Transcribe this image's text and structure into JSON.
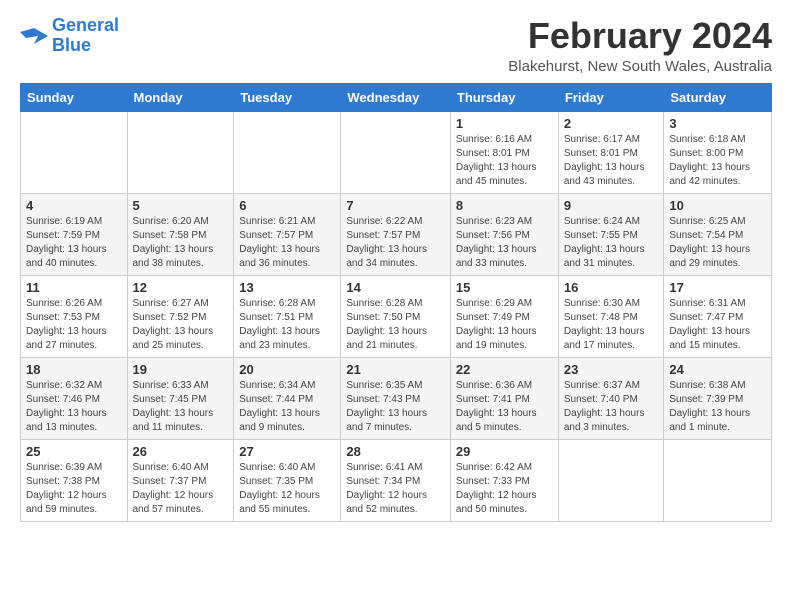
{
  "logo": {
    "text_general": "General",
    "text_blue": "Blue"
  },
  "header": {
    "title": "February 2024",
    "subtitle": "Blakehurst, New South Wales, Australia"
  },
  "days_of_week": [
    "Sunday",
    "Monday",
    "Tuesday",
    "Wednesday",
    "Thursday",
    "Friday",
    "Saturday"
  ],
  "weeks": [
    [
      {
        "day": "",
        "detail": ""
      },
      {
        "day": "",
        "detail": ""
      },
      {
        "day": "",
        "detail": ""
      },
      {
        "day": "",
        "detail": ""
      },
      {
        "day": "1",
        "detail": "Sunrise: 6:16 AM\nSunset: 8:01 PM\nDaylight: 13 hours\nand 45 minutes."
      },
      {
        "day": "2",
        "detail": "Sunrise: 6:17 AM\nSunset: 8:01 PM\nDaylight: 13 hours\nand 43 minutes."
      },
      {
        "day": "3",
        "detail": "Sunrise: 6:18 AM\nSunset: 8:00 PM\nDaylight: 13 hours\nand 42 minutes."
      }
    ],
    [
      {
        "day": "4",
        "detail": "Sunrise: 6:19 AM\nSunset: 7:59 PM\nDaylight: 13 hours\nand 40 minutes."
      },
      {
        "day": "5",
        "detail": "Sunrise: 6:20 AM\nSunset: 7:58 PM\nDaylight: 13 hours\nand 38 minutes."
      },
      {
        "day": "6",
        "detail": "Sunrise: 6:21 AM\nSunset: 7:57 PM\nDaylight: 13 hours\nand 36 minutes."
      },
      {
        "day": "7",
        "detail": "Sunrise: 6:22 AM\nSunset: 7:57 PM\nDaylight: 13 hours\nand 34 minutes."
      },
      {
        "day": "8",
        "detail": "Sunrise: 6:23 AM\nSunset: 7:56 PM\nDaylight: 13 hours\nand 33 minutes."
      },
      {
        "day": "9",
        "detail": "Sunrise: 6:24 AM\nSunset: 7:55 PM\nDaylight: 13 hours\nand 31 minutes."
      },
      {
        "day": "10",
        "detail": "Sunrise: 6:25 AM\nSunset: 7:54 PM\nDaylight: 13 hours\nand 29 minutes."
      }
    ],
    [
      {
        "day": "11",
        "detail": "Sunrise: 6:26 AM\nSunset: 7:53 PM\nDaylight: 13 hours\nand 27 minutes."
      },
      {
        "day": "12",
        "detail": "Sunrise: 6:27 AM\nSunset: 7:52 PM\nDaylight: 13 hours\nand 25 minutes."
      },
      {
        "day": "13",
        "detail": "Sunrise: 6:28 AM\nSunset: 7:51 PM\nDaylight: 13 hours\nand 23 minutes."
      },
      {
        "day": "14",
        "detail": "Sunrise: 6:28 AM\nSunset: 7:50 PM\nDaylight: 13 hours\nand 21 minutes."
      },
      {
        "day": "15",
        "detail": "Sunrise: 6:29 AM\nSunset: 7:49 PM\nDaylight: 13 hours\nand 19 minutes."
      },
      {
        "day": "16",
        "detail": "Sunrise: 6:30 AM\nSunset: 7:48 PM\nDaylight: 13 hours\nand 17 minutes."
      },
      {
        "day": "17",
        "detail": "Sunrise: 6:31 AM\nSunset: 7:47 PM\nDaylight: 13 hours\nand 15 minutes."
      }
    ],
    [
      {
        "day": "18",
        "detail": "Sunrise: 6:32 AM\nSunset: 7:46 PM\nDaylight: 13 hours\nand 13 minutes."
      },
      {
        "day": "19",
        "detail": "Sunrise: 6:33 AM\nSunset: 7:45 PM\nDaylight: 13 hours\nand 11 minutes."
      },
      {
        "day": "20",
        "detail": "Sunrise: 6:34 AM\nSunset: 7:44 PM\nDaylight: 13 hours\nand 9 minutes."
      },
      {
        "day": "21",
        "detail": "Sunrise: 6:35 AM\nSunset: 7:43 PM\nDaylight: 13 hours\nand 7 minutes."
      },
      {
        "day": "22",
        "detail": "Sunrise: 6:36 AM\nSunset: 7:41 PM\nDaylight: 13 hours\nand 5 minutes."
      },
      {
        "day": "23",
        "detail": "Sunrise: 6:37 AM\nSunset: 7:40 PM\nDaylight: 13 hours\nand 3 minutes."
      },
      {
        "day": "24",
        "detail": "Sunrise: 6:38 AM\nSunset: 7:39 PM\nDaylight: 13 hours\nand 1 minute."
      }
    ],
    [
      {
        "day": "25",
        "detail": "Sunrise: 6:39 AM\nSunset: 7:38 PM\nDaylight: 12 hours\nand 59 minutes."
      },
      {
        "day": "26",
        "detail": "Sunrise: 6:40 AM\nSunset: 7:37 PM\nDaylight: 12 hours\nand 57 minutes."
      },
      {
        "day": "27",
        "detail": "Sunrise: 6:40 AM\nSunset: 7:35 PM\nDaylight: 12 hours\nand 55 minutes."
      },
      {
        "day": "28",
        "detail": "Sunrise: 6:41 AM\nSunset: 7:34 PM\nDaylight: 12 hours\nand 52 minutes."
      },
      {
        "day": "29",
        "detail": "Sunrise: 6:42 AM\nSunset: 7:33 PM\nDaylight: 12 hours\nand 50 minutes."
      },
      {
        "day": "",
        "detail": ""
      },
      {
        "day": "",
        "detail": ""
      }
    ]
  ]
}
